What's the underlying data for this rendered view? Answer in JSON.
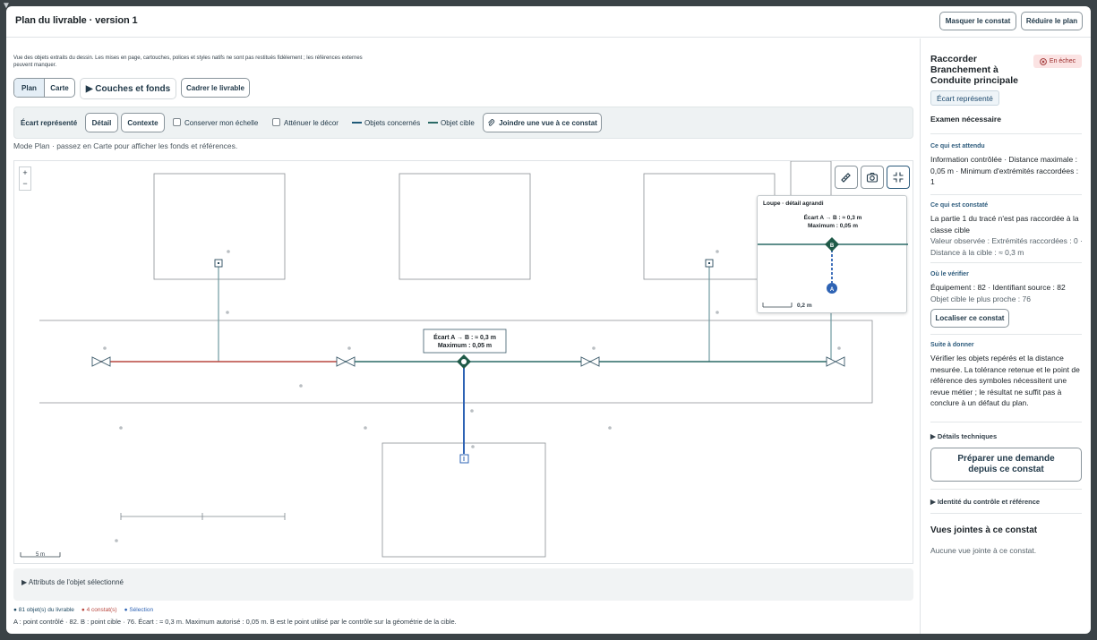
{
  "window": {
    "title": "Plan du livrable · version 1",
    "btn_hide": "Masquer le constat",
    "btn_reduce": "Réduire le plan"
  },
  "main": {
    "notice": "Vue des objets extraits du dessin. Les mises en page, cartouches, polices et styles natifs ne sont pas restitués fidèlement ; les références externes peuvent manquer.",
    "view_plan": "Plan",
    "view_map": "Carte",
    "layers": "▶ Couches et fonds",
    "frame_btn": "Cadrer le livrable",
    "mode_note": "Mode Plan · passez en Carte pour afficher les fonds et références."
  },
  "toolbar": {
    "gap_label": "Écart représenté",
    "detail": "Détail",
    "context": "Contexte",
    "keep_scale": "Conserver mon échelle",
    "dim_decor": "Atténuer le décor",
    "objects_concerned": "Objets concernés",
    "target_object": "Objet cible",
    "attach_view": "Joindre une vue à ce constat"
  },
  "map": {
    "zoom_in": "+",
    "zoom_out": "−",
    "gap_label_line1": "Écart A → B : ≈ 0,3 m",
    "gap_label_line2": "Maximum : 0,05 m",
    "scale_label": "5 m",
    "marker_a": "A",
    "marker_b": "B",
    "marker_mid": "B"
  },
  "loupe": {
    "title": "Loupe · détail agrandi",
    "line1": "Écart A → B : ≈ 0,3 m",
    "line2": "Maximum : 0,05 m",
    "scale": "0,2 m",
    "marker_a": "A",
    "marker_b": "B"
  },
  "bottom": {
    "attributes": "▶ Attributs de l'objet sélectionné",
    "legend_objects": "● 81 objet(s) du livrable",
    "legend_findings": "● 4 constat(s)",
    "legend_selection": "● Sélection",
    "caption": "A : point contrôlé · 82. B : point cible · 76. Écart : ≈ 0,3 m. Maximum autorisé : 0,05 m. B est le point utilisé par le contrôle sur la géométrie de la cible."
  },
  "panel": {
    "title": "Raccorder Branchement à Conduite principale",
    "status": "En échec",
    "chip": "Écart représenté",
    "review": "Examen nécessaire",
    "expected_h": "Ce qui est attendu",
    "expected_t": "Information contrôlée · Distance maximale : 0,05 m · Minimum d'extrémités raccordées : 1",
    "observed_h": "Ce qui est constaté",
    "observed_t": "La partie 1 du tracé n'est pas raccordée à la classe cible",
    "observed_sub": "Valeur observée : Extrémités raccordées : 0 · Distance à la cible : ≈ 0,3 m",
    "where_h": "Où le vérifier",
    "where_t": "Équipement : 82 · Identifiant source : 82",
    "where_sub": "Objet cible le plus proche : 76",
    "locate_btn": "Localiser ce constat",
    "next_h": "Suite à donner",
    "next_t": "Vérifier les objets repérés et la distance mesurée. La tolérance retenue et le point de référence des symboles nécessitent une revue métier ; le résultat ne suffit pas à conclure à un défaut du plan.",
    "tech_details": "▶ Détails techniques",
    "prepare_btn": "Préparer une demande depuis ce constat",
    "identity": "▶ Identité du contrôle et référence",
    "views_h": "Vues jointes à ce constat",
    "views_t": "Aucune vue jointe à ce constat."
  },
  "colors": {
    "accent": "#1f4a63",
    "pipe_main": "#2a6a66",
    "pipe_fail": "#b9473f",
    "selection": "#2e63b4",
    "fail": "#c0392b"
  }
}
